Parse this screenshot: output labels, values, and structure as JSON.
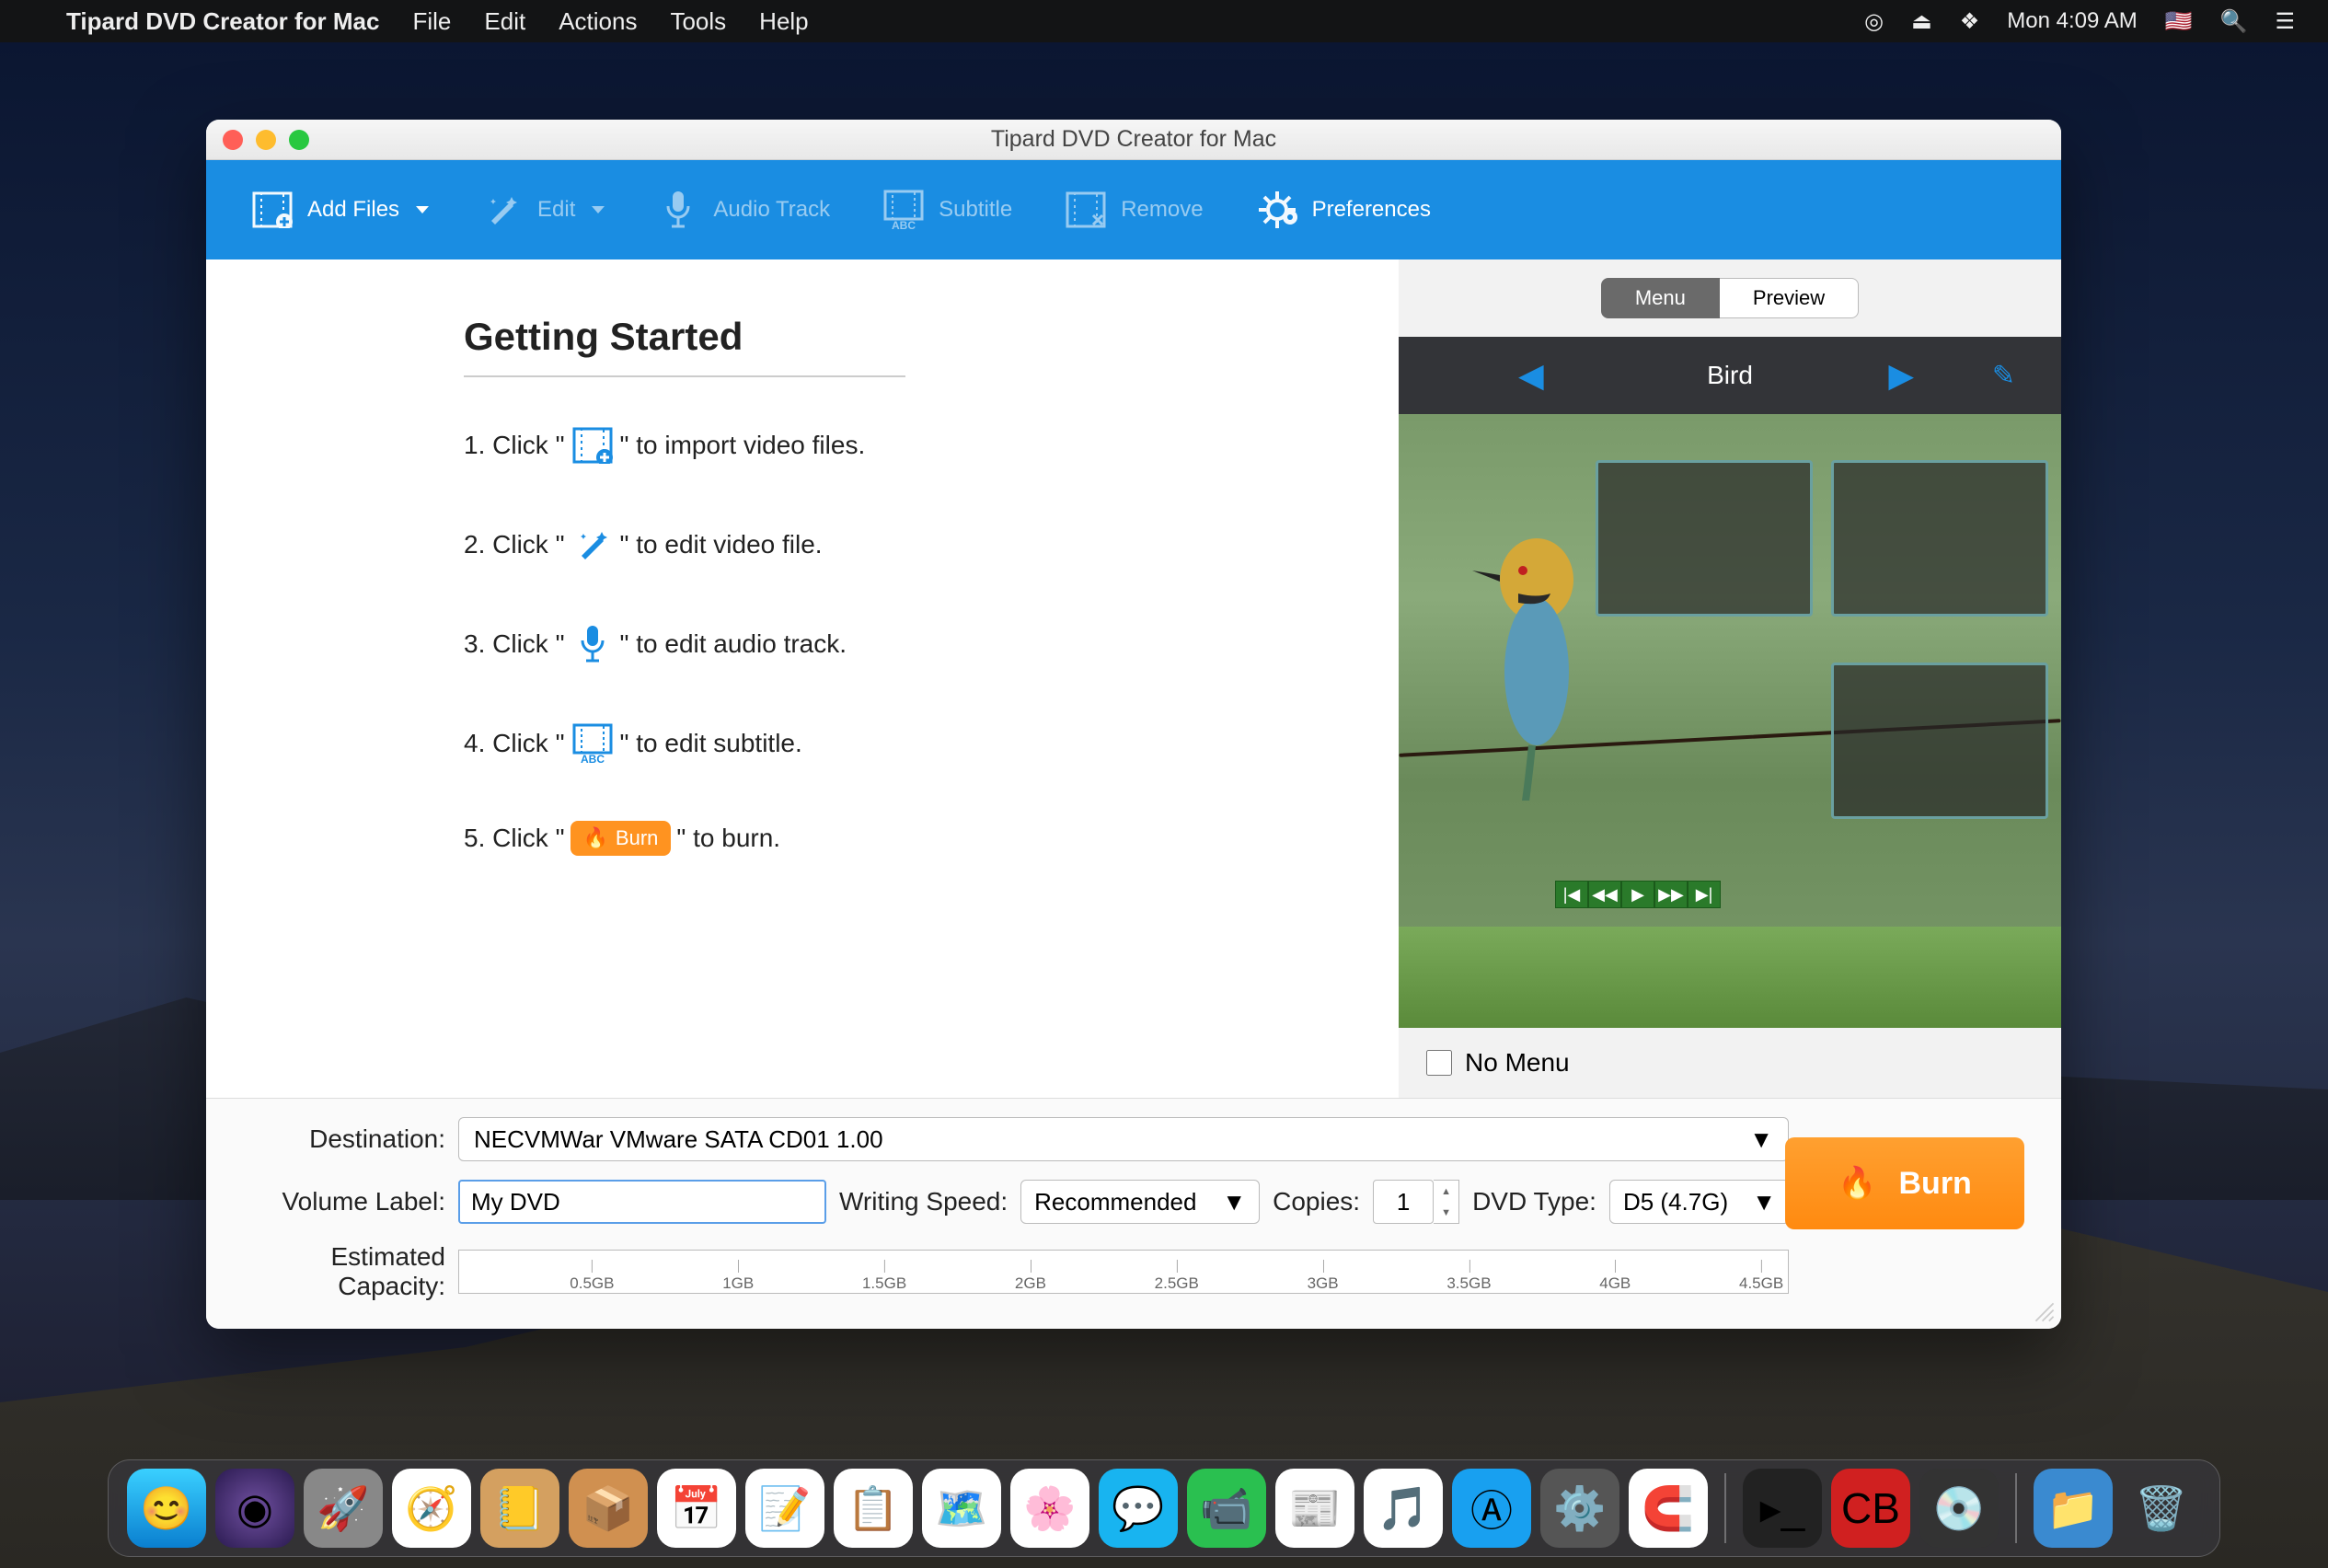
{
  "menubar": {
    "app_name": "Tipard DVD Creator for Mac",
    "menus": [
      "File",
      "Edit",
      "Actions",
      "Tools",
      "Help"
    ],
    "clock": "Mon 4:09 AM"
  },
  "window": {
    "title": "Tipard DVD Creator for Mac"
  },
  "toolbar": {
    "add_files": "Add Files",
    "edit": "Edit",
    "audio_track": "Audio Track",
    "subtitle": "Subtitle",
    "remove": "Remove",
    "preferences": "Preferences"
  },
  "getting_started": {
    "title": "Getting Started",
    "step1_pre": "1. Click \"",
    "step1_post": "\" to import video files.",
    "step2_pre": "2. Click \"",
    "step2_post": "\" to edit video file.",
    "step3_pre": "3. Click \"",
    "step3_post": "\" to edit audio track.",
    "step4_pre": "4. Click \"",
    "step4_post": "\" to edit subtitle.",
    "step5_pre": "5. Click \"",
    "step5_post": "\" to burn.",
    "burn_chip": "Burn"
  },
  "tabs": {
    "menu": "Menu",
    "preview": "Preview"
  },
  "menu_theme": {
    "name": "Bird"
  },
  "no_menu": "No Menu",
  "bottom": {
    "destination_label": "Destination:",
    "destination_value": "NECVMWar VMware SATA CD01 1.00",
    "volume_label_label": "Volume Label:",
    "volume_label_value": "My DVD",
    "writing_speed_label": "Writing Speed:",
    "writing_speed_value": "Recommended",
    "copies_label": "Copies:",
    "copies_value": "1",
    "dvd_type_label": "DVD Type:",
    "dvd_type_value": "D5 (4.7G)",
    "capacity_label": "Estimated Capacity:",
    "ticks": [
      "0.5GB",
      "1GB",
      "1.5GB",
      "2GB",
      "2.5GB",
      "3GB",
      "3.5GB",
      "4GB",
      "4.5GB"
    ]
  },
  "burn_button": "Burn"
}
